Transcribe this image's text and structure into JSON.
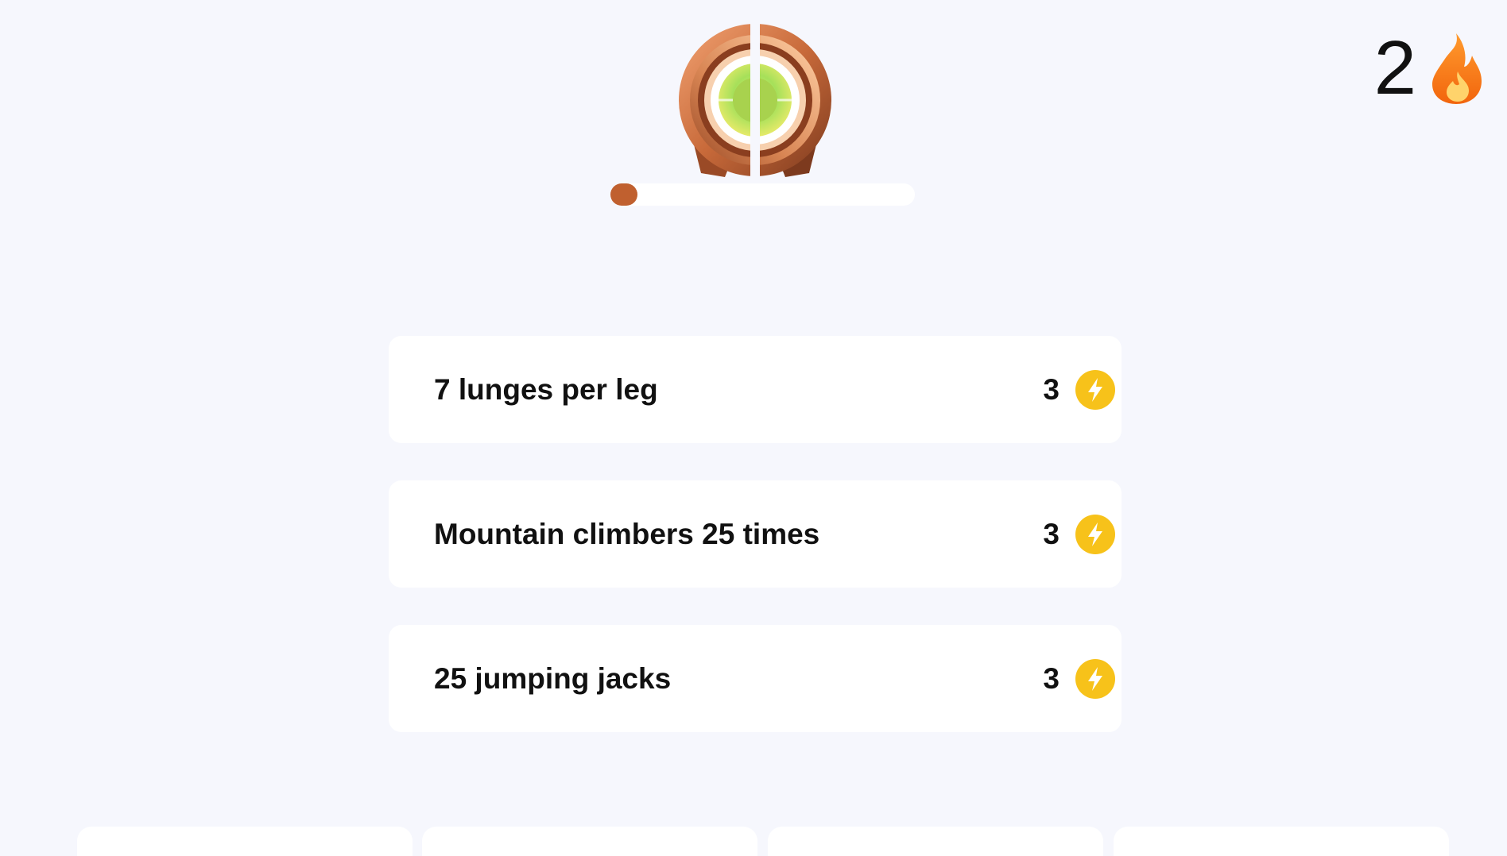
{
  "streak": {
    "count": "2",
    "icon": "flame-icon"
  },
  "badge": {
    "icon": "bronze-medal-icon",
    "progress": 0.08
  },
  "tasks": [
    {
      "label": "7 lunges per leg",
      "reward": "3",
      "icon": "lightning-bolt-icon"
    },
    {
      "label": "Mountain climbers 25 times",
      "reward": "3",
      "icon": "lightning-bolt-icon"
    },
    {
      "label": "25 jumping jacks",
      "reward": "3",
      "icon": "lightning-bolt-icon"
    }
  ],
  "colors": {
    "background": "#f6f7fd",
    "progress_fill": "#c0602f",
    "bolt": "#f7c21a",
    "flame": "#f47b16"
  }
}
